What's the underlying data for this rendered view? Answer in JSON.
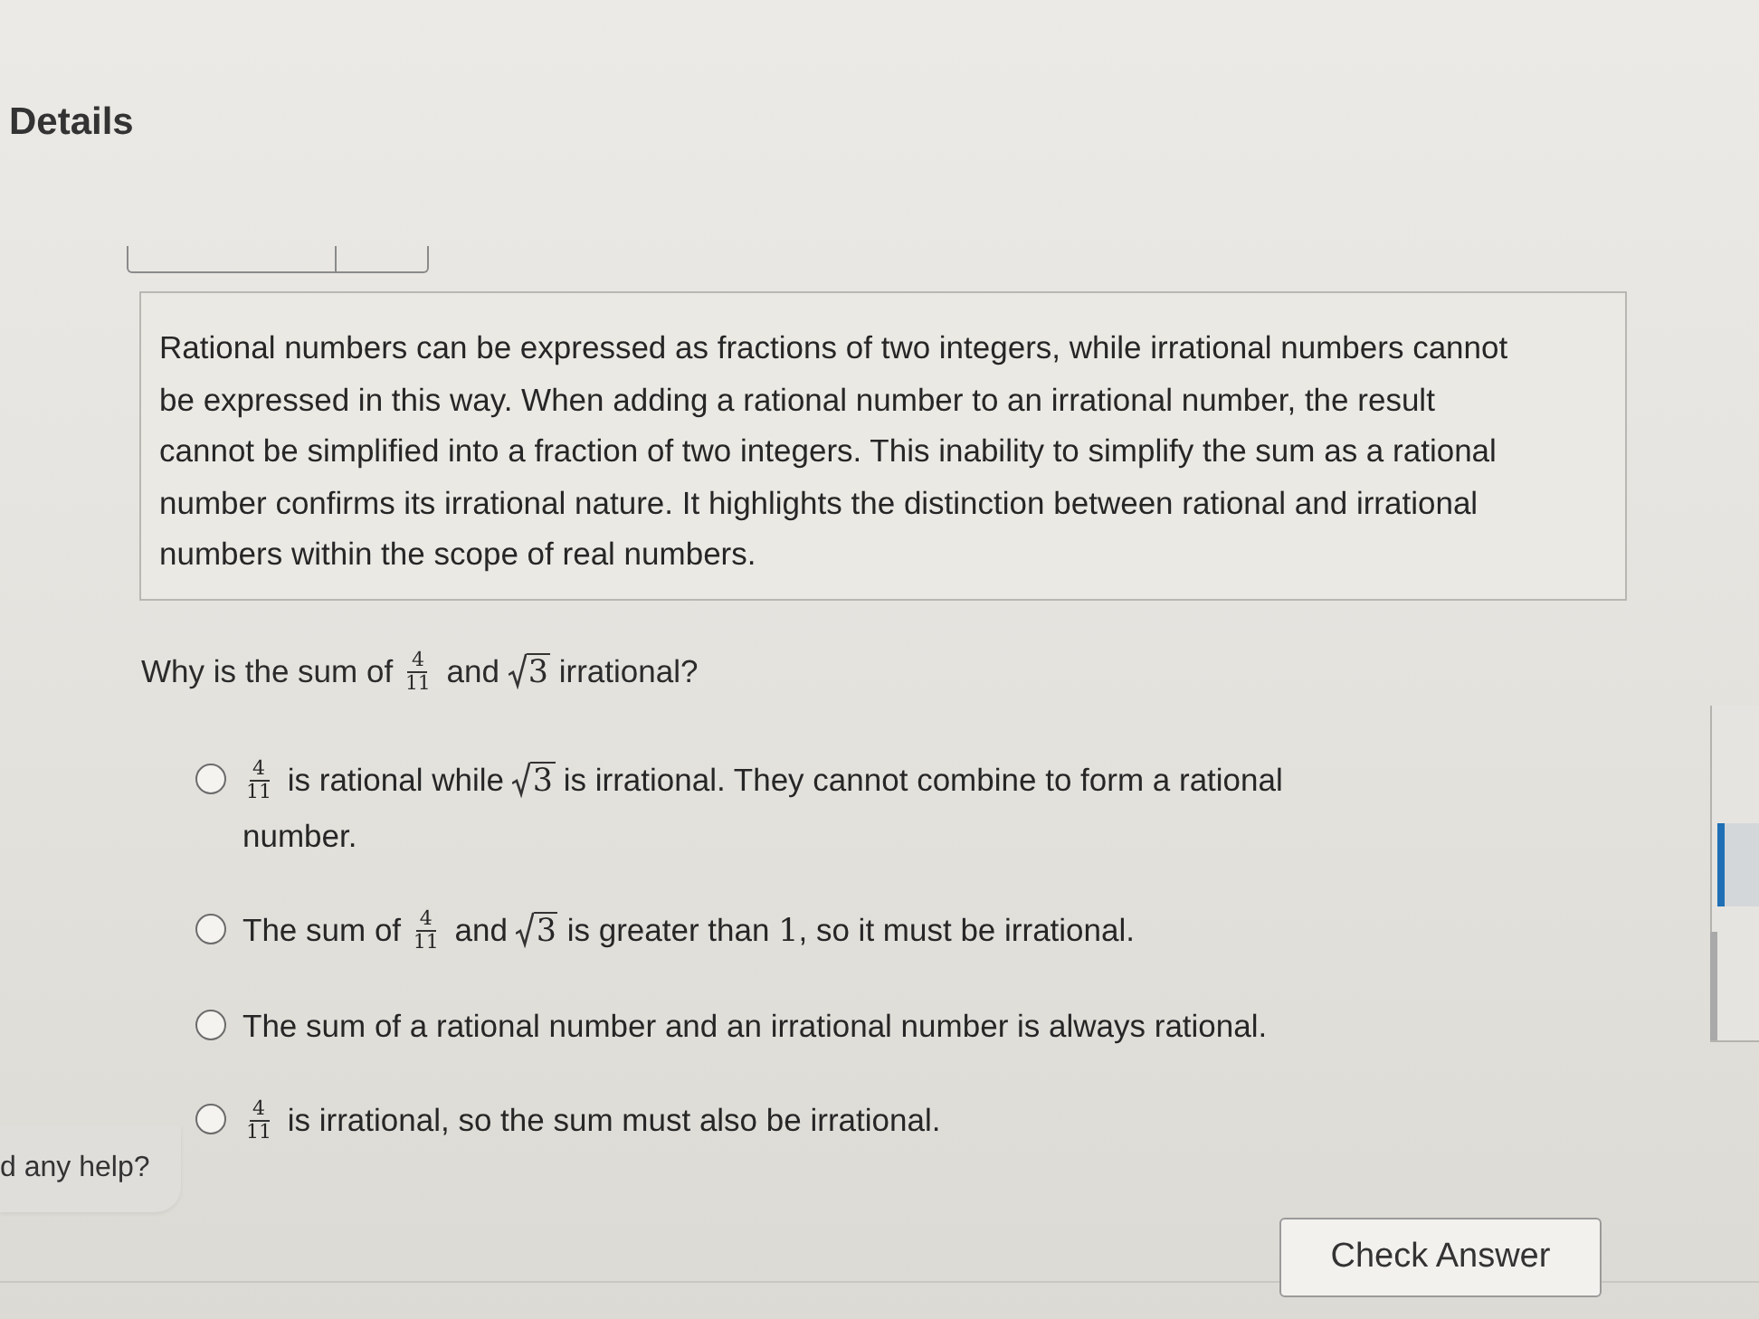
{
  "heading": "Details",
  "explanation": "Rational numbers can be expressed as fractions of two integers, while irrational numbers cannot be expressed in this way. When adding a rational number to an irrational number, the result cannot be simplified into a fraction of two integers. This inability to simplify the sum as a rational number confirms its irrational nature. It highlights the distinction between rational and irrational numbers within the scope of real numbers.",
  "question": [
    {
      "kind": "text",
      "text": "Why is the sum of "
    },
    {
      "kind": "frac",
      "num": "4",
      "den": "11"
    },
    {
      "kind": "text",
      "text": " and "
    },
    {
      "kind": "sqrt",
      "text": "3"
    },
    {
      "kind": "text",
      "text": " irrational?"
    }
  ],
  "options": [
    {
      "selected": false,
      "parts": [
        {
          "kind": "frac",
          "num": "4",
          "den": "11"
        },
        {
          "kind": "text",
          "text": " is rational while "
        },
        {
          "kind": "sqrt",
          "text": "3"
        },
        {
          "kind": "text",
          "text": " is irrational. They cannot combine to form a rational number."
        }
      ]
    },
    {
      "selected": false,
      "parts": [
        {
          "kind": "text",
          "text": "The sum of "
        },
        {
          "kind": "frac",
          "num": "4",
          "den": "11"
        },
        {
          "kind": "text",
          "text": " and "
        },
        {
          "kind": "sqrt",
          "text": "3"
        },
        {
          "kind": "text",
          "text": " is greater than "
        },
        {
          "kind": "num",
          "text": "1"
        },
        {
          "kind": "text",
          "text": ", so it must be irrational."
        }
      ]
    },
    {
      "selected": false,
      "parts": [
        {
          "kind": "text",
          "text": "The sum of a rational number and an irrational number is always rational."
        }
      ]
    },
    {
      "selected": false,
      "parts": [
        {
          "kind": "frac",
          "num": "4",
          "den": "11"
        },
        {
          "kind": "text",
          "text": " is irrational, so the sum must also be irrational."
        }
      ]
    }
  ],
  "help": "d any help?",
  "check_button": "Check Answer"
}
